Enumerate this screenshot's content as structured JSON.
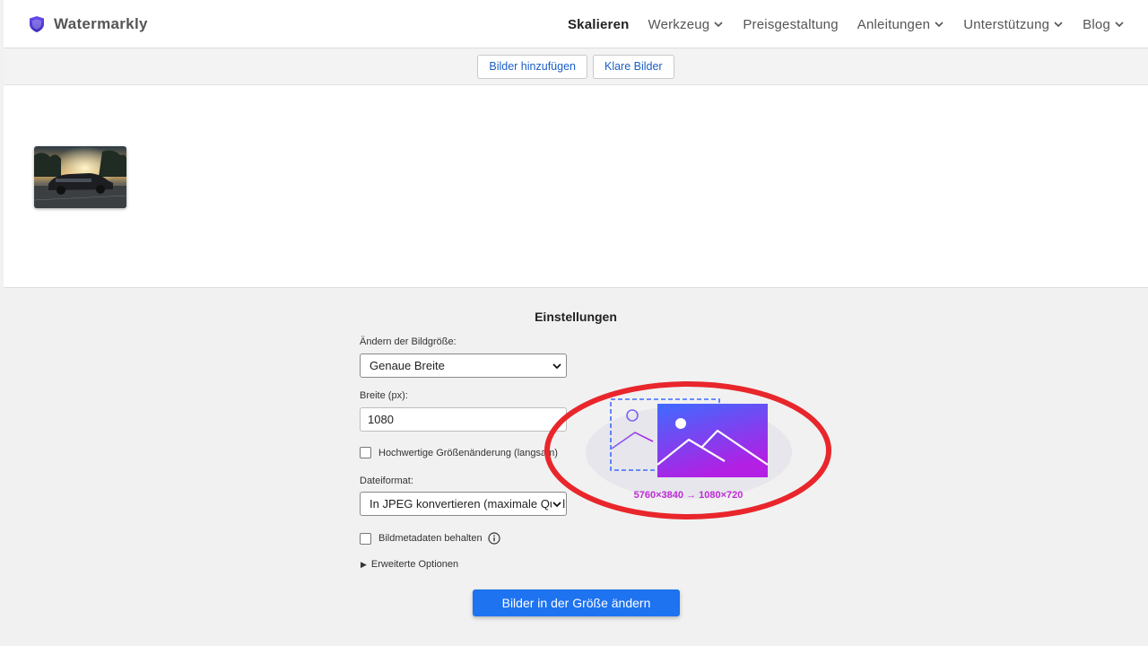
{
  "header": {
    "logo_text": "Watermarkly",
    "logo_icon": "shield-icon",
    "nav": [
      {
        "label": "Skalieren",
        "active": true,
        "dropdown": false
      },
      {
        "label": "Werkzeug",
        "active": false,
        "dropdown": true
      },
      {
        "label": "Preisgestaltung",
        "active": false,
        "dropdown": false
      },
      {
        "label": "Anleitungen",
        "active": false,
        "dropdown": true
      },
      {
        "label": "Unterstützung",
        "active": false,
        "dropdown": true
      },
      {
        "label": "Blog",
        "active": false,
        "dropdown": true
      }
    ]
  },
  "toolbar": {
    "add_images_label": "Bilder hinzufügen",
    "clear_images_label": "Klare Bilder"
  },
  "images": [
    {
      "type": "car-photo-thumbnail"
    }
  ],
  "settings": {
    "title": "Einstellungen",
    "resize_label": "Ändern der Bildgröße:",
    "resize_value": "Genaue Breite",
    "width_label": "Breite (px):",
    "width_value": "1080",
    "hq_label": "Hochwertige Größenänderung (langsam)",
    "hq_checked": false,
    "format_label": "Dateiformat:",
    "format_value": "In JPEG konvertieren (maximale Qualität)",
    "metadata_label": "Bildmetadaten behalten",
    "metadata_checked": false,
    "advanced_label": "Erweiterte Optionen",
    "submit_label": "Bilder in der Größe ändern"
  },
  "illustration": {
    "dimensions_text": "5760×3840 → 1080×720"
  },
  "colors": {
    "accent_blue": "#1d73f0",
    "link_blue": "#1a5fc7",
    "annotation_red": "#e8262b",
    "gradient_start": "#3e6bff",
    "gradient_end": "#b31fe3"
  }
}
